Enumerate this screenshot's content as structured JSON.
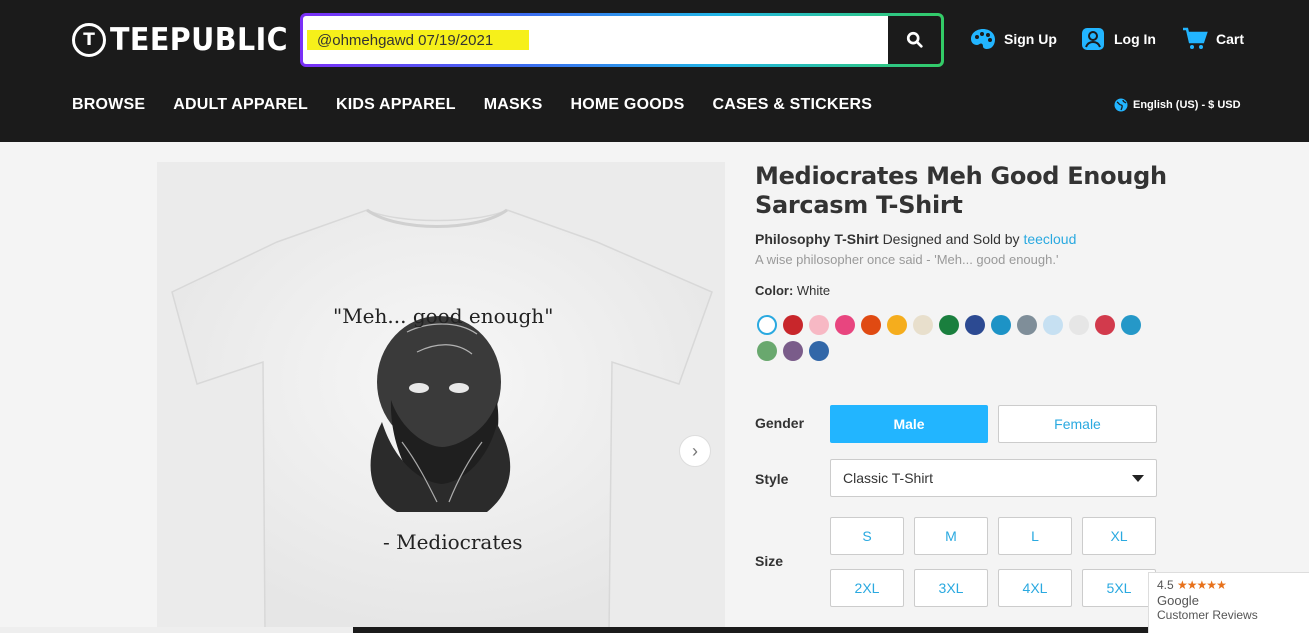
{
  "header": {
    "logo_text": "TEEPUBLIC",
    "search": {
      "value": "@ohmehgawd 07/19/2021",
      "placeholder": ""
    },
    "sign_up": "Sign Up",
    "log_in": "Log In",
    "cart": "Cart",
    "locale": "English (US) - $ USD"
  },
  "nav": [
    "BROWSE",
    "ADULT APPAREL",
    "KIDS APPAREL",
    "MASKS",
    "HOME GOODS",
    "CASES & STICKERS"
  ],
  "product": {
    "title": "Mediocrates Meh Good Enough Sarcasm T-Shirt",
    "category": "Philosophy T-Shirt",
    "designed_by_text": "Designed and Sold by",
    "designer": "teecloud",
    "description": "A wise philosopher once said - 'Meh... good enough.'",
    "color_label": "Color:",
    "color_value": "White",
    "shirt_quote": "\"Meh... good enough\"",
    "shirt_attrib": "- Mediocrates",
    "swatch_colors": [
      "#ffffff",
      "#c8262b",
      "#f7b8c4",
      "#e8457f",
      "#e04a12",
      "#f5ad1d",
      "#e8dfcc",
      "#1a7f3e",
      "#2c4a92",
      "#1d93c6",
      "#7f8e99",
      "#c6e0f2",
      "#e6e6e6",
      "#d23a4c",
      "#2598c8",
      "#69a86e",
      "#7a5c8a",
      "#3267a8"
    ]
  },
  "options": {
    "gender_label": "Gender",
    "male": "Male",
    "female": "Female",
    "style_label": "Style",
    "style_value": "Classic T-Shirt",
    "size_label": "Size",
    "sizes": [
      "S",
      "M",
      "L",
      "XL",
      "2XL",
      "3XL",
      "4XL",
      "5XL"
    ]
  },
  "google_reviews": {
    "rating": "4.5",
    "stars": "★★★★★",
    "line1": "Google",
    "line2": "Customer Reviews"
  },
  "colors": {
    "accent": "#22b5ff",
    "link": "#2aa9e0",
    "header_bg": "#1b1b1b"
  }
}
